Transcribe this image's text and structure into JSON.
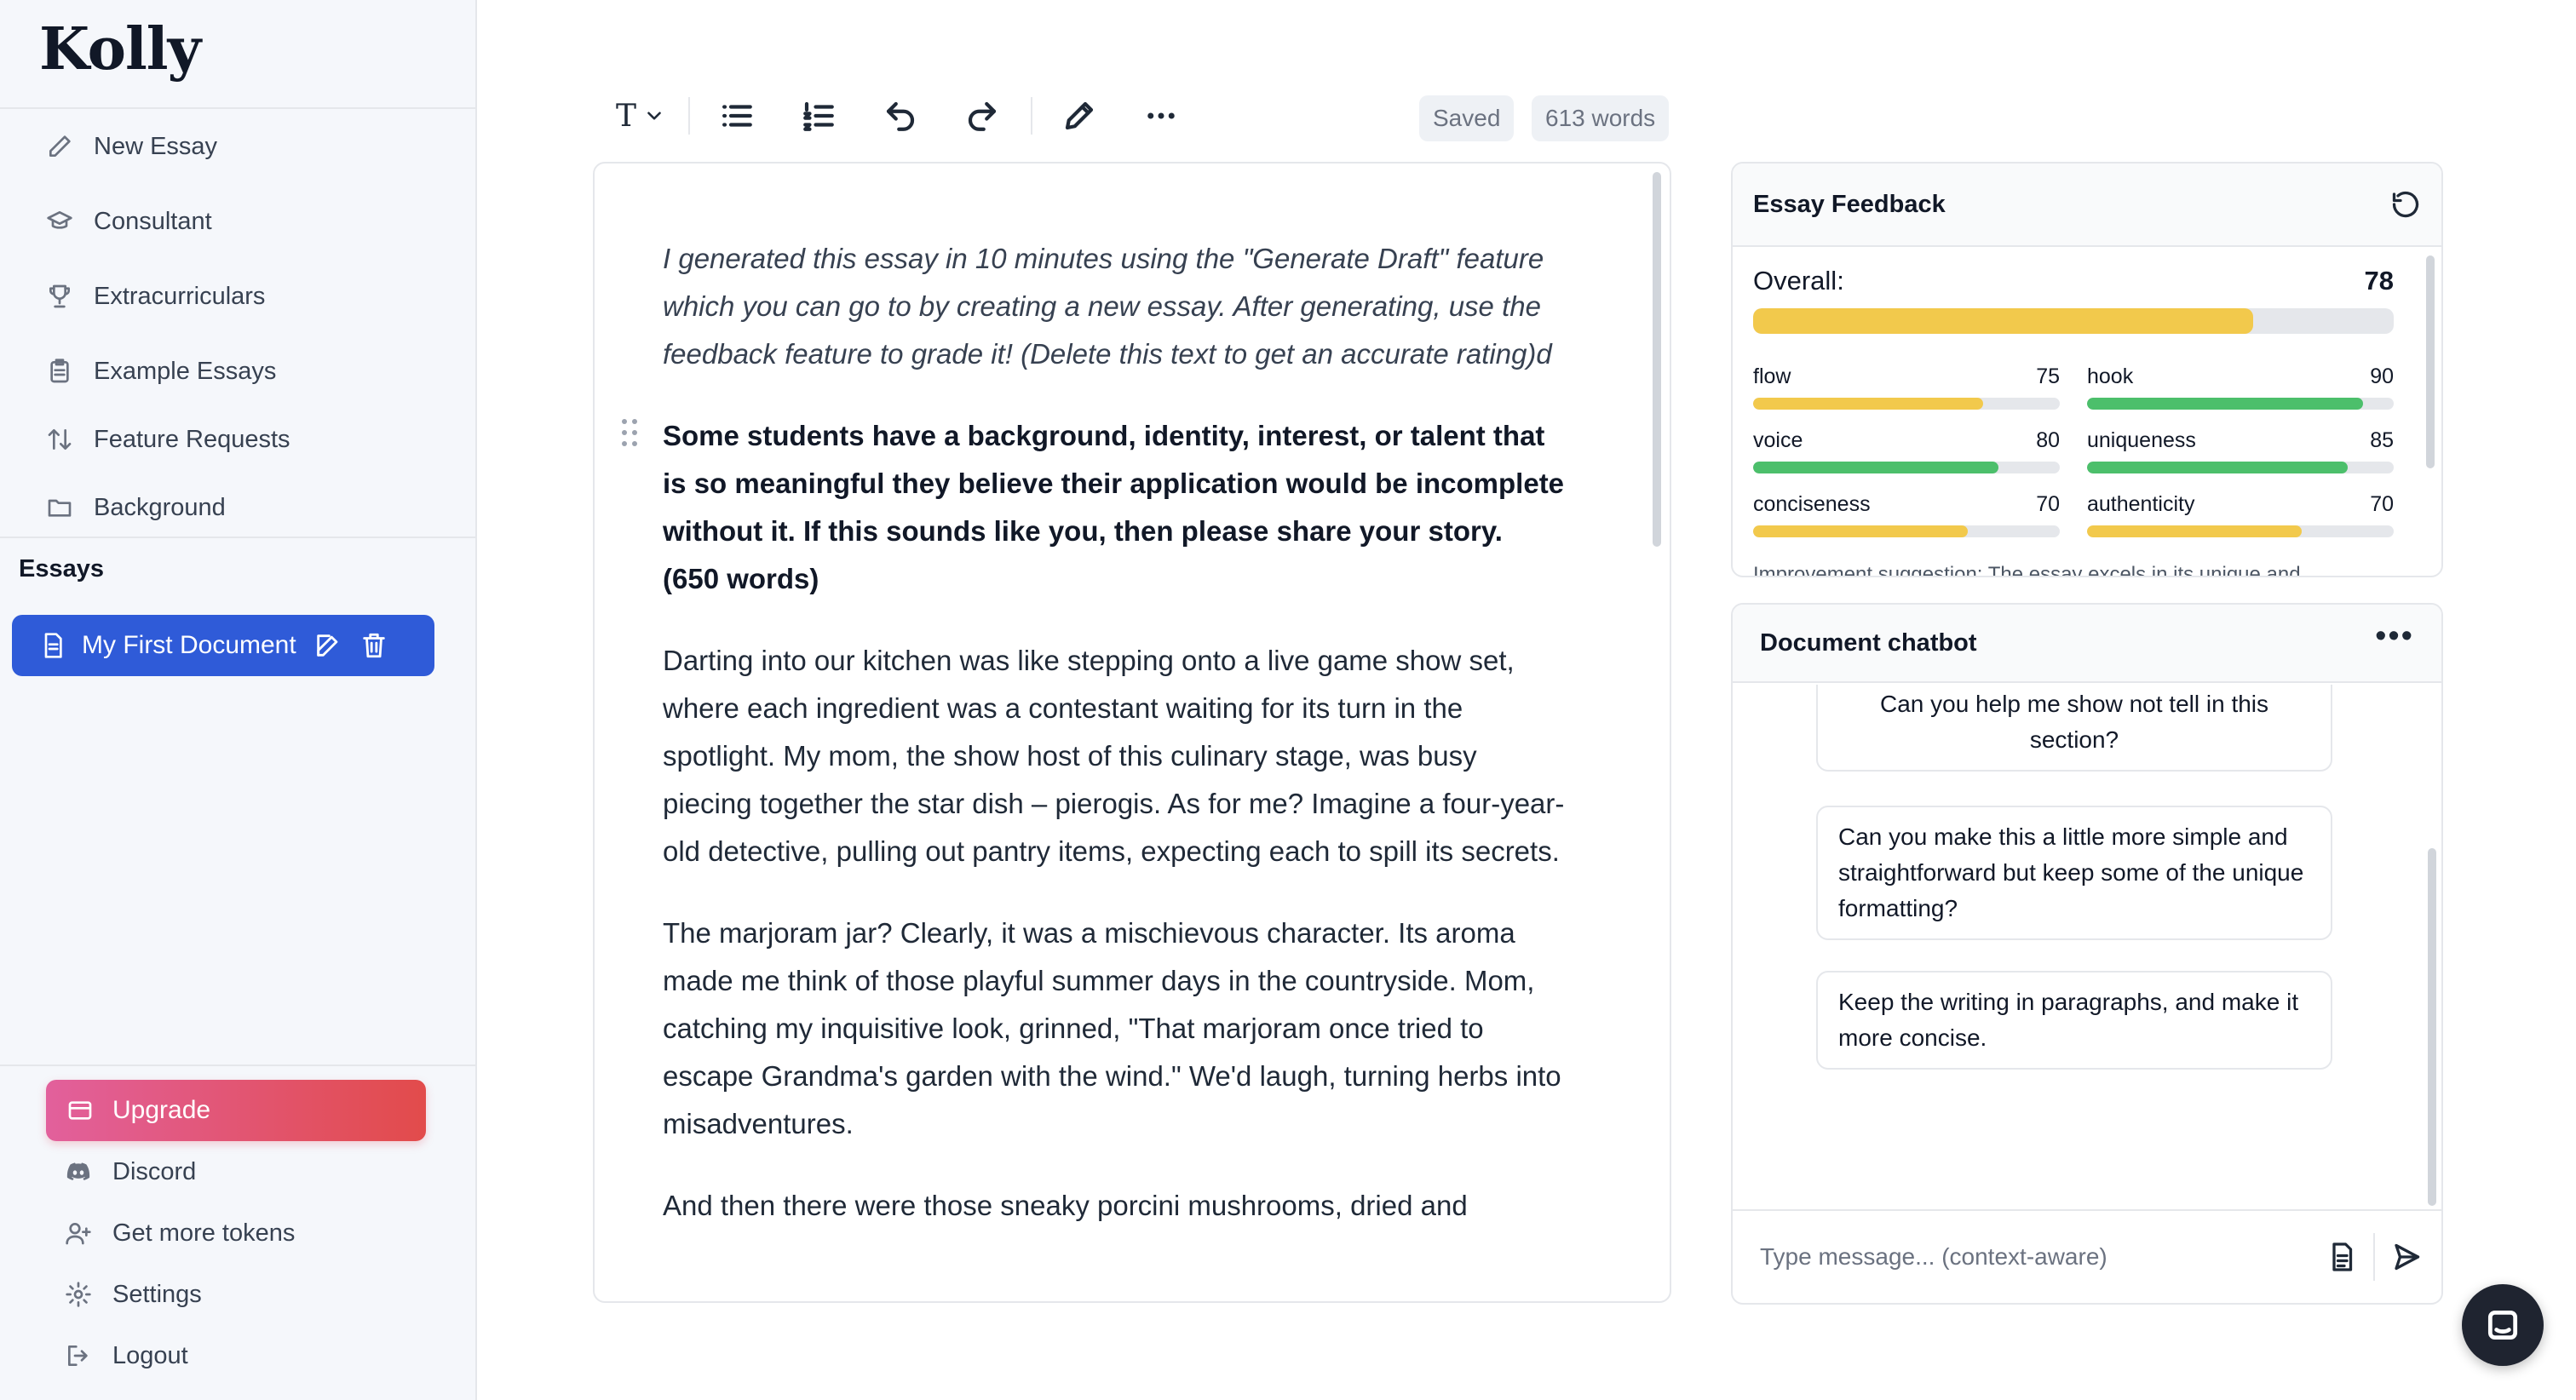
{
  "app": {
    "logo": "Kolly"
  },
  "sidebar": {
    "nav": [
      {
        "label": "New Essay",
        "icon": "pencil-icon"
      },
      {
        "label": "Consultant",
        "icon": "graduation-cap-icon"
      },
      {
        "label": "Extracurriculars",
        "icon": "trophy-icon"
      },
      {
        "label": "Example Essays",
        "icon": "clipboard-icon"
      },
      {
        "label": "Feature Requests",
        "icon": "sort-arrows-icon"
      },
      {
        "label": "Background",
        "icon": "folder-icon"
      }
    ],
    "essays_heading": "Essays",
    "documents": [
      {
        "label": "My First Document"
      }
    ],
    "upgrade_label": "Upgrade",
    "bottom": [
      {
        "label": "Discord",
        "icon": "discord-icon"
      },
      {
        "label": "Get more tokens",
        "icon": "add-user-icon"
      },
      {
        "label": "Settings",
        "icon": "gear-icon"
      },
      {
        "label": "Logout",
        "icon": "logout-icon"
      }
    ]
  },
  "toolbar": {
    "text_style": "T",
    "status": "Saved",
    "word_count": "613 words"
  },
  "editor": {
    "paragraphs": [
      {
        "style": "italic",
        "text": "I generated this essay in 10 minutes using the \"Generate Draft\" feature which you can go to by creating a new essay. After generating, use the feedback feature to grade it! (Delete this text to get an accurate rating)d"
      },
      {
        "style": "bold",
        "text": "Some students have a background, identity, interest, or talent that is so meaningful they believe their application would be incomplete without it. If this sounds like you, then please share your story. (650 words)"
      },
      {
        "style": "normal",
        "text": "Darting into our kitchen was like stepping onto a live game show set, where each ingredient was a contestant waiting for its turn in the spotlight. My mom, the show host of this culinary stage, was busy piecing together the star dish – pierogis. As for me? Imagine a four-year-old detective, pulling out pantry items, expecting each to spill its secrets."
      },
      {
        "style": "normal",
        "text": "The marjoram jar? Clearly, it was a mischievous character. Its aroma made me think of those playful summer days in the countryside. Mom, catching my inquisitive look, grinned, \"That marjoram once tried to escape Grandma's garden with the wind.\" We'd laugh, turning herbs into misadventures."
      },
      {
        "style": "normal",
        "text": "And then there were those sneaky porcini mushrooms, dried and"
      }
    ]
  },
  "feedback": {
    "title": "Essay Feedback",
    "overall_label": "Overall:",
    "overall_score": 78,
    "metrics": [
      {
        "name": "flow",
        "score": 75,
        "color": "#f2c94c"
      },
      {
        "name": "hook",
        "score": 90,
        "color": "#4cbf6b"
      },
      {
        "name": "voice",
        "score": 80,
        "color": "#4cbf6b"
      },
      {
        "name": "uniqueness",
        "score": 85,
        "color": "#4cbf6b"
      },
      {
        "name": "conciseness",
        "score": 70,
        "color": "#f2c94c"
      },
      {
        "name": "authenticity",
        "score": 70,
        "color": "#f2c94c"
      }
    ],
    "overall_color": "#f2c94c",
    "suggestion": "Improvement suggestion: The essay excels in its unique and"
  },
  "chatbot": {
    "title": "Document chatbot",
    "messages": [
      "Can you help me show not tell in this section?",
      "Can you make this a little more simple and straightforward but keep some of the unique formatting?",
      "Keep the writing in paragraphs, and make it more concise."
    ],
    "input_placeholder": "Type message... (context-aware)"
  },
  "colors": {
    "accent": "#2f5bd8",
    "upgrade_gradient_start": "#e2609c",
    "upgrade_gradient_end": "#e24b4b"
  }
}
